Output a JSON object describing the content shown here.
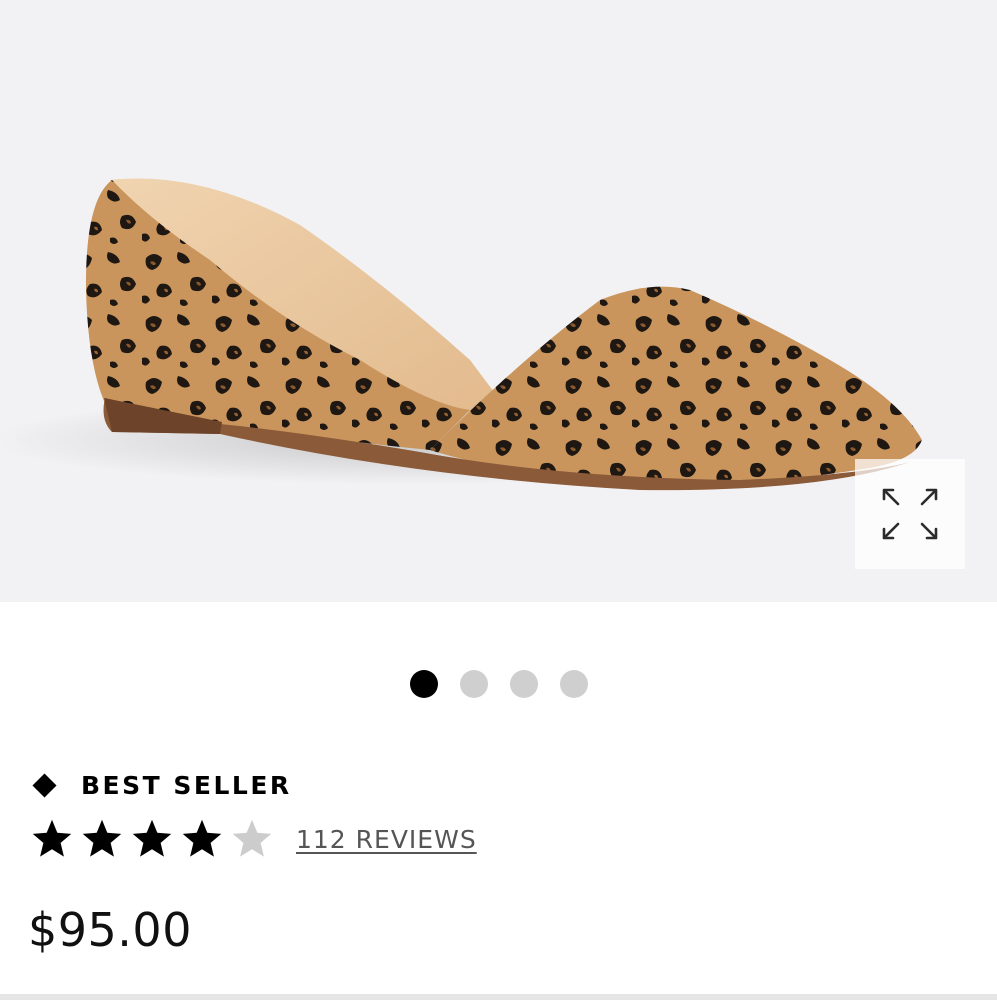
{
  "gallery": {
    "product_image_icon": "leopard-print-flat-shoe",
    "expand_icon": "expand-arrows-icon",
    "slides": [
      {
        "active": true
      },
      {
        "active": false
      },
      {
        "active": false
      },
      {
        "active": false
      }
    ]
  },
  "badge": {
    "icon": "diamond-icon",
    "label": "BEST SELLER"
  },
  "rating": {
    "stars": 4,
    "max_stars": 5,
    "reviews_label": "112 REVIEWS"
  },
  "price": "$95.00",
  "colors": {
    "hero_bg": "#f2f2f4",
    "active_dot": "#000000",
    "inactive_dot": "#cfcfcf",
    "empty_star": "#cccccc"
  }
}
